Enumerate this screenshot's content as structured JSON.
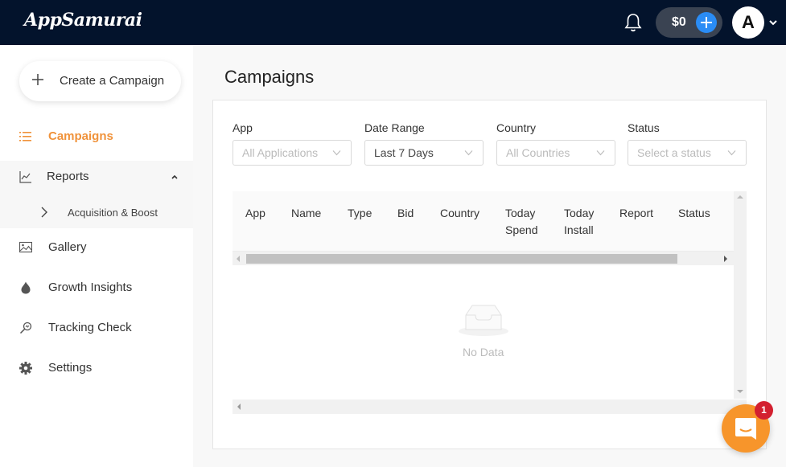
{
  "header": {
    "brand": "AppSamurai",
    "balance": "$0",
    "avatar_initial": "A"
  },
  "sidebar": {
    "create_label": "Create a Campaign",
    "items": [
      {
        "label": "Campaigns",
        "icon": "list-icon",
        "active": true
      },
      {
        "label": "Reports",
        "icon": "chart-line-icon",
        "expanded": true
      },
      {
        "label": "Gallery",
        "icon": "image-icon"
      },
      {
        "label": "Growth Insights",
        "icon": "flame-icon"
      },
      {
        "label": "Tracking Check",
        "icon": "magnifier-icon"
      },
      {
        "label": "Settings",
        "icon": "gear-icon"
      }
    ],
    "reports_sub": [
      {
        "label": "Acquisition & Boost"
      }
    ]
  },
  "main": {
    "title": "Campaigns",
    "filters": [
      {
        "label": "App",
        "value": "All Applications",
        "placeholder": true
      },
      {
        "label": "Date Range",
        "value": "Last 7 Days",
        "placeholder": false
      },
      {
        "label": "Country",
        "value": "All Countries",
        "placeholder": true
      },
      {
        "label": "Status",
        "value": "Select a status",
        "placeholder": true
      }
    ],
    "table": {
      "columns": [
        "App",
        "Name",
        "Type",
        "Bid",
        "Country",
        "Today Spend",
        "Today Install",
        "Report",
        "Status"
      ],
      "columns_lines": [
        [
          "App"
        ],
        [
          "Name"
        ],
        [
          "Type"
        ],
        [
          "Bid"
        ],
        [
          "Country"
        ],
        [
          "Today",
          "Spend"
        ],
        [
          "Today",
          "Install"
        ],
        [
          "Report"
        ],
        [
          "Status"
        ]
      ],
      "rows": [],
      "empty_text": "No Data"
    }
  },
  "chat": {
    "unread_count": "1"
  },
  "colors": {
    "topbar": "#03132c",
    "accent": "#f0923a",
    "wallet_add": "#2a8cf5",
    "chat": "#f7952b",
    "badge": "#d32030"
  }
}
